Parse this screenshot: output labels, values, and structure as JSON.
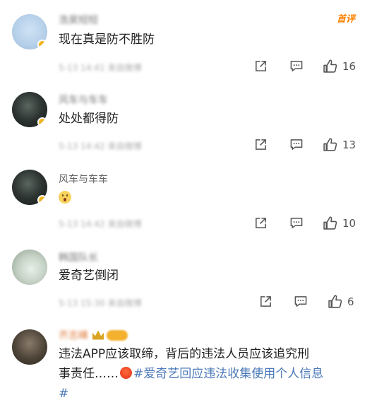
{
  "comments": [
    {
      "username": "浩昊短短",
      "content": "现在真是防不胜防",
      "meta": "5-13 14:41 来自微博",
      "likes": "16",
      "badge": "首评"
    },
    {
      "username": "风车与车车",
      "content": "处处都得防",
      "meta": "5-13 14:42 来自微博",
      "likes": "13"
    },
    {
      "username": "风车与车车",
      "content": "",
      "meta": "5-13 14:42 来自微博",
      "likes": "10"
    },
    {
      "username": "韩国队长",
      "content": "爱奇艺倒闭",
      "meta": "5-13 15:30 来自微博",
      "likes": "6"
    },
    {
      "username": "齐志峰",
      "content_line1": "违法APP应该取缔，背后的违法人员应该追究刑",
      "content_line2_plain": "事责任……",
      "content_line2_tag": "#爱奇艺回应违法收集使用个人信息",
      "content_line3": "#"
    }
  ],
  "colors": {
    "accent_orange": "#ff8200",
    "hashtag_blue": "#4a78b8",
    "verified_gold": "#f2b31b"
  }
}
